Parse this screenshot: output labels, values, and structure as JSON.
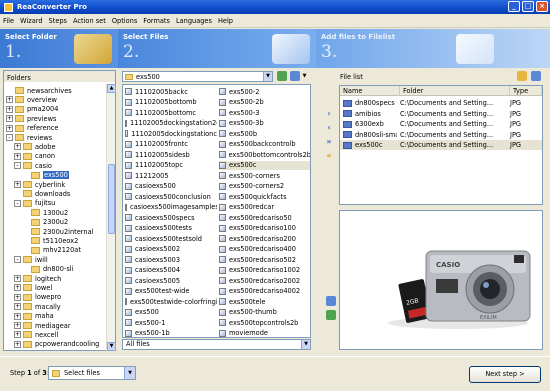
{
  "window": {
    "title": "ReaConverter Pro"
  },
  "menu": [
    "File",
    "Wizard",
    "Steps",
    "Action set",
    "Options",
    "Formats",
    "Languages",
    "Help"
  ],
  "steps": [
    {
      "label": "Select Folder",
      "number": "1."
    },
    {
      "label": "Select Files",
      "number": "2."
    },
    {
      "label": "Add files to Filelist",
      "number": "3."
    }
  ],
  "folders": {
    "header": "Folders",
    "tree": [
      {
        "label": "newsarchives",
        "level": 2,
        "exp": ""
      },
      {
        "label": "overview",
        "level": 2,
        "exp": "+"
      },
      {
        "label": "pma2004",
        "level": 2,
        "exp": "+"
      },
      {
        "label": "previews",
        "level": 2,
        "exp": "+"
      },
      {
        "label": "reference",
        "level": 2,
        "exp": "+"
      },
      {
        "label": "reviews",
        "level": 2,
        "exp": "-"
      },
      {
        "label": "adobe",
        "level": 3,
        "exp": "+"
      },
      {
        "label": "canon",
        "level": 3,
        "exp": "+"
      },
      {
        "label": "casio",
        "level": 3,
        "exp": "-"
      },
      {
        "label": "exs500",
        "level": 4,
        "exp": "",
        "selected": true
      },
      {
        "label": "cyberlink",
        "level": 3,
        "exp": "+"
      },
      {
        "label": "downloads",
        "level": 3,
        "exp": ""
      },
      {
        "label": "fujitsu",
        "level": 3,
        "exp": "-"
      },
      {
        "label": "1300u2",
        "level": 4,
        "exp": ""
      },
      {
        "label": "2300u2",
        "level": 4,
        "exp": ""
      },
      {
        "label": "2300u2internal",
        "level": 4,
        "exp": ""
      },
      {
        "label": "t5110eox2",
        "level": 4,
        "exp": ""
      },
      {
        "label": "mhv2120at",
        "level": 4,
        "exp": ""
      },
      {
        "label": "iwill",
        "level": 3,
        "exp": "-"
      },
      {
        "label": "dn800-sli",
        "level": 4,
        "exp": ""
      },
      {
        "label": "logitech",
        "level": 3,
        "exp": "+"
      },
      {
        "label": "lowel",
        "level": 3,
        "exp": "+"
      },
      {
        "label": "lowepro",
        "level": 3,
        "exp": "+"
      },
      {
        "label": "macally",
        "level": 3,
        "exp": "+"
      },
      {
        "label": "maha",
        "level": 3,
        "exp": "+"
      },
      {
        "label": "mediagear",
        "level": 3,
        "exp": "+"
      },
      {
        "label": "nexcell",
        "level": 3,
        "exp": "+"
      },
      {
        "label": "pcpowerandcooling",
        "level": 3,
        "exp": "+"
      }
    ]
  },
  "files": {
    "current_folder": "exs500",
    "col1": [
      "11102005backc",
      "11102005bottomb",
      "11102005bottomc",
      "11102005dockingstation2c",
      "11102005dockingstationc",
      "11102005frontc",
      "11102005sidesb",
      "11102005topc",
      "11212005",
      "casioexs500",
      "casioexs500conclusion",
      "casioexs500imagesamples",
      "casioexs500specs",
      "casioexs500tests",
      "casioexs500testsold",
      "casioexs5002",
      "casioexs5003",
      "casioexs5004",
      "casioexs5005",
      "exs500test-wide",
      "exs500testwide-colorfringing1",
      "exs500",
      "exs500-1",
      "exs500-1b"
    ],
    "col2": [
      "exs500-2",
      "exs500-2b",
      "exs500-3",
      "exs500-3b",
      "exs500b",
      "exs500backcontrolb",
      "exs500bottomcontrols2b",
      "exs500c",
      "exs500-corners",
      "exs500-corners2",
      "exs500quickfacts",
      "exs500redcar",
      "exs500redcariso50",
      "exs500redcariso100",
      "exs500redcariso200",
      "exs500redcariso400",
      "exs500redcariso502",
      "exs500redcariso1002",
      "exs500redcariso2002",
      "exs500redcariso4002",
      "exs500tele",
      "exs500-thumb",
      "exs500topcontrols2b",
      "moviemode"
    ],
    "selected": "exs500c",
    "filter": "All files"
  },
  "filelist": {
    "title": "File list",
    "columns": [
      "Name",
      "Folder",
      "Type"
    ],
    "rows": [
      {
        "name": "dn800specs",
        "folder": "C:\\Documents and Setting...",
        "type": "JPG"
      },
      {
        "name": "amibios",
        "folder": "C:\\Documents and Setting...",
        "type": "JPG"
      },
      {
        "name": "6300exb",
        "folder": "C:\\Documents and Setting...",
        "type": "JPG"
      },
      {
        "name": "dn800sli-small",
        "folder": "C:\\Documents and Setting...",
        "type": "JPG"
      },
      {
        "name": "exs500c",
        "folder": "C:\\Documents and Setting...",
        "type": "JPG",
        "selected": true
      }
    ]
  },
  "preview": {
    "camera_brand": "CASIO",
    "camera_lens": "EXILIM",
    "card_label": "2GB"
  },
  "bottom": {
    "step_prefix": "Step ",
    "step_current": "1",
    "step_of": " of ",
    "step_total": "3",
    "step_suffix": ":",
    "step_select": "Select files",
    "next": "Next step >"
  },
  "colors": {
    "accent": "#316ac5",
    "step_banner": "#3d7cd8"
  }
}
